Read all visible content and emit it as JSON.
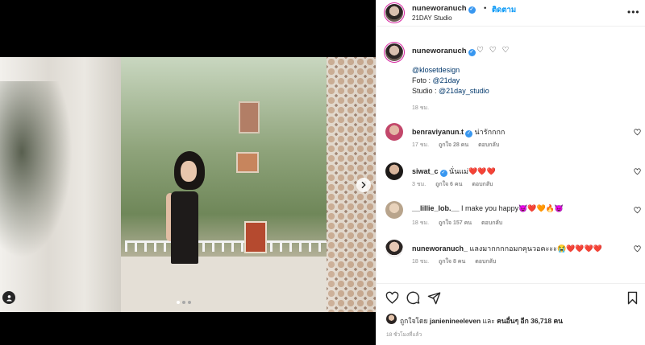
{
  "header": {
    "username": "nuneworanuch",
    "dot": "•",
    "follow_label": "ติดตาม",
    "location": "21DAY Studio",
    "more_icon": "more-horizontal-icon"
  },
  "caption": {
    "username": "nuneworanuch",
    "hearts": "♡ ♡ ♡",
    "line1": "@klosetdesign",
    "line2_prefix": "Foto : ",
    "line2_link": "@21day",
    "line3_prefix": "Studio : ",
    "line3_link": "@21day_studio",
    "time": "18 ชม."
  },
  "comments": [
    {
      "username": "benraviyanun.t",
      "verified": true,
      "text": "น่ารักกกก",
      "time": "17 ชม.",
      "likes": "ถูกใจ 28 คน",
      "reply": "ตอบกลับ"
    },
    {
      "username": "siwat_c",
      "verified": true,
      "text": "นั่นแม่",
      "emoji": "❤️❤️❤️",
      "time": "3 ชม.",
      "likes": "ถูกใจ 6 คน",
      "reply": "ตอบกลับ"
    },
    {
      "username": "__lillie_lob.__",
      "verified": false,
      "text": "I make you happy",
      "emoji": "😈❤️🧡🔥😈",
      "time": "18 ชม.",
      "likes": "ถูกใจ 157 คน",
      "reply": "ตอบกลับ"
    },
    {
      "username": "nuneworanuch_",
      "verified": false,
      "text": "แลงมากกกกอมกคุนวอคะะะ",
      "emoji": "😭❤️❤️❤️❤️",
      "time": "18 ชม.",
      "likes": "ถูกใจ 8 คน",
      "reply": "ตอบกลับ"
    }
  ],
  "actions": {
    "like_icon": "heart-icon",
    "comment_icon": "comment-icon",
    "share_icon": "share-icon",
    "save_icon": "bookmark-icon"
  },
  "liked_by": {
    "prefix": "ถูกใจโดย ",
    "user": "janienineeleven",
    "middle": " และ ",
    "others": "คนอื่นๆ อีก 36,718 คน"
  },
  "post_time": "18 ชั่วโมงที่แล้ว",
  "media": {
    "carousel_total": 3,
    "carousel_active": 1
  },
  "colors": {
    "accent": "#0095f6",
    "verified": "#3897f0",
    "muted": "#8e8e8e",
    "text": "#262626"
  }
}
